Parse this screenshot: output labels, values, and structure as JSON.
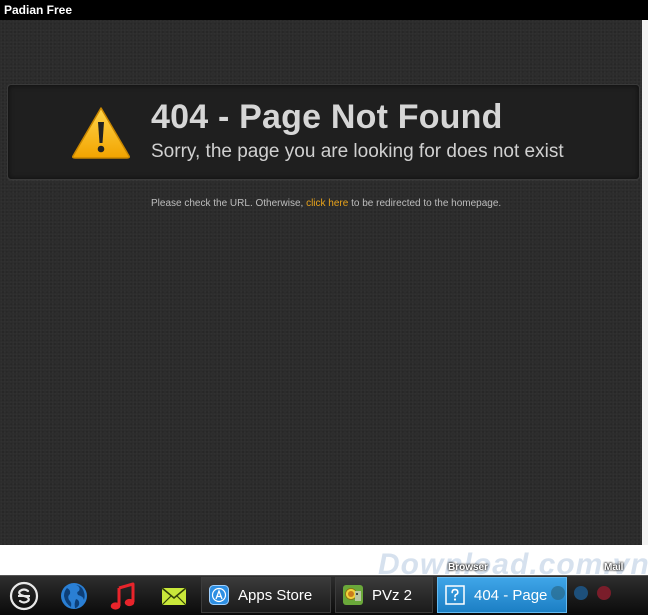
{
  "window": {
    "title": "Padian Free"
  },
  "page": {
    "error_title": "404 - Page Not Found",
    "error_subtitle": "Sorry, the page you are looking for does not exist",
    "help_before": "Please check the URL. Otherwise, ",
    "help_link": "click here",
    "help_after": " to be redirected to the homepage."
  },
  "dock": {
    "browser_label": "Browser",
    "mail_label": "Mail"
  },
  "taskbar": {
    "launchers": [
      {
        "icon": "padian-logo-icon"
      },
      {
        "icon": "globe-icon"
      },
      {
        "icon": "music-note-icon"
      },
      {
        "icon": "mail-envelope-icon"
      }
    ],
    "tasks": [
      {
        "label": "Apps Store",
        "icon": "app-store-icon",
        "active": false
      },
      {
        "label": "PVz 2",
        "icon": "pvz-game-icon",
        "active": false
      },
      {
        "label": "404 - Page",
        "icon": "question-page-icon",
        "active": true
      }
    ]
  },
  "colors": {
    "background": "#2c2c2c",
    "link": "#e8a21a",
    "warning": "#f6b81c",
    "active_task": "#2a8fd6"
  }
}
